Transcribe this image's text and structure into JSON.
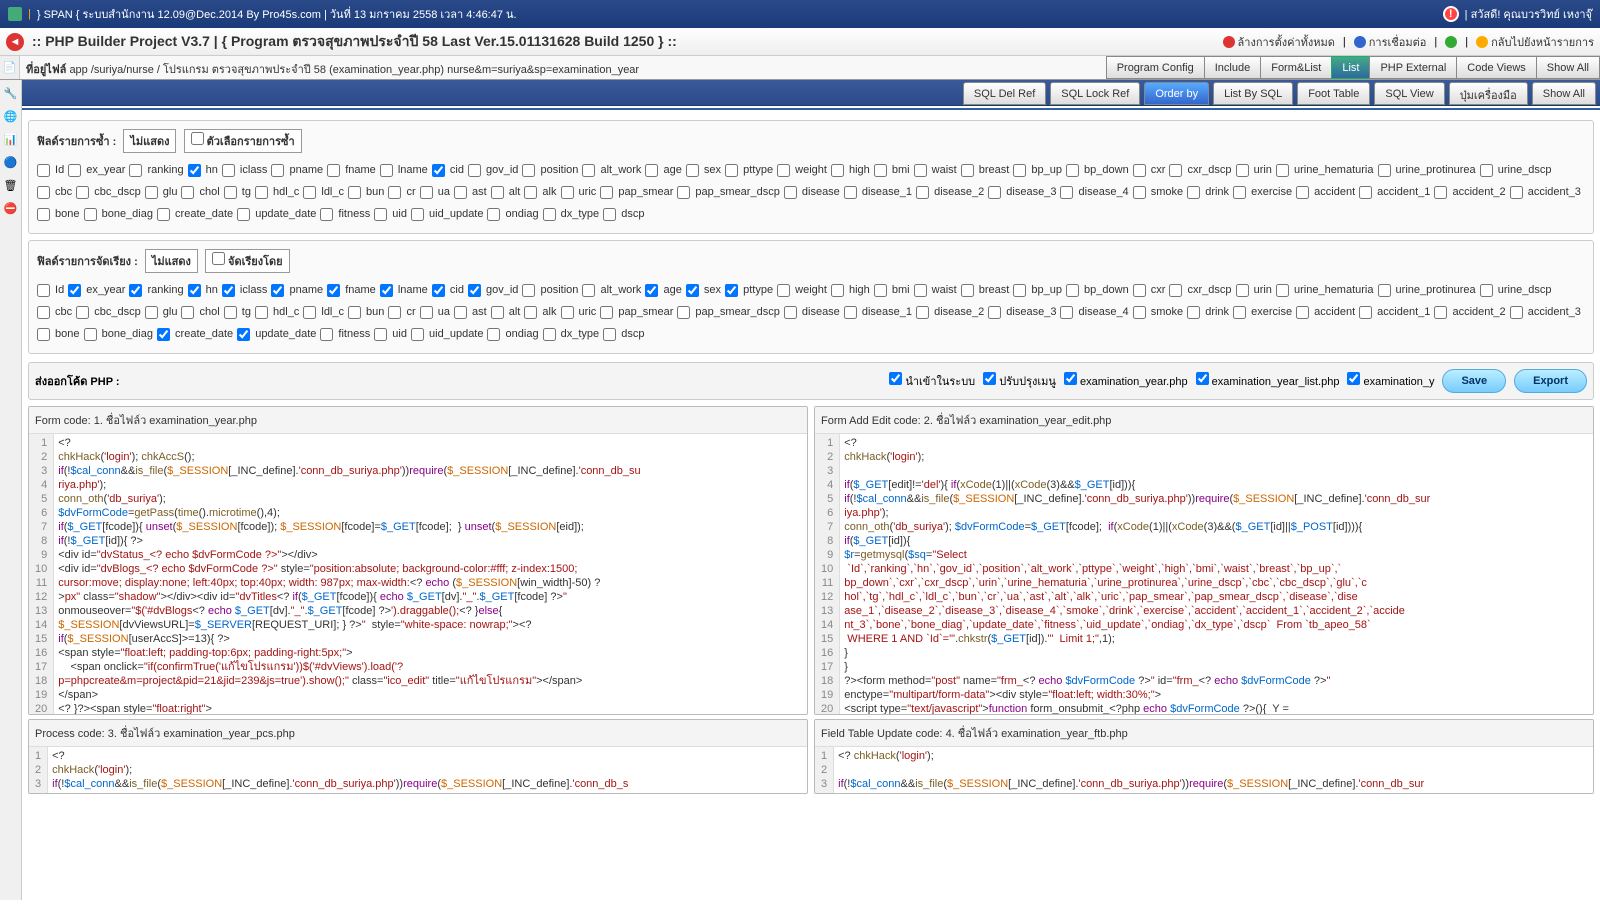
{
  "titlebar": {
    "left": "} SPAN { ระบบสำนักงาน 12.09@Dec.2014 By Pro45s.com | วันที่ 13 มกราคม 2558 เวลา 4:46:47 น.",
    "right": "| สวัสดี! คุณบวรวิทย์ เหงาจุ๊"
  },
  "subheader": {
    "title": ":: PHP Builder Project V3.7 | { Program ตรวจสุขภาพประจำปี 58 Last Ver.15.01131628 Build 1250 } ::",
    "actions": {
      "clear": "ล้างการตั้งค่าทั้งหมด",
      "connect": "การเชื่อมต่อ",
      "back": "กลับไปยังหน้ารายการ"
    }
  },
  "pathbar": {
    "label": "ที่อยู่ไฟล์",
    "path": "app /suriya/nurse / โปรแกรม ตรวจสุขภาพประจำปี 58 (examination_year.php) nurse&m=suriya&sp=examination_year",
    "tabs": [
      "Program Config",
      "Include",
      "Form&List",
      "List",
      "PHP External",
      "Code Views",
      "Show All"
    ],
    "active": 3
  },
  "toolbar2": {
    "tabs": [
      "SQL Del Ref",
      "SQL Lock Ref",
      "Order by",
      "List By SQL",
      "Foot Table",
      "SQL View",
      "ปุ่มเครื่องมือ",
      "Show All"
    ],
    "active": 2
  },
  "fieldRepeat": {
    "title": "ฟิลด์รายการซ้ำ :",
    "box1": "ไม่แสดง",
    "box2": "ตัวเลือกรายการซ้ำ"
  },
  "fieldSort": {
    "title": "ฟิลด์รายการจัดเรียง :",
    "box1": "ไม่แสดง",
    "box2": "จัดเรียงโดย"
  },
  "fields": [
    "Id",
    "ex_year",
    "ranking",
    "hn",
    "iclass",
    "pname",
    "fname",
    "lname",
    "cid",
    "gov_id",
    "position",
    "alt_work",
    "age",
    "sex",
    "pttype",
    "weight",
    "high",
    "bmi",
    "waist",
    "breast",
    "bp_up",
    "bp_down",
    "cxr",
    "cxr_dscp",
    "urin",
    "urine_hematuria",
    "urine_protinurea",
    "urine_dscp",
    "cbc",
    "cbc_dscp",
    "glu",
    "chol",
    "tg",
    "hdl_c",
    "ldl_c",
    "bun",
    "cr",
    "ua",
    "ast",
    "alt",
    "alk",
    "uric",
    "pap_smear",
    "pap_smear_dscp",
    "disease",
    "disease_1",
    "disease_2",
    "disease_3",
    "disease_4",
    "smoke",
    "drink",
    "exercise",
    "accident",
    "accident_1",
    "accident_2",
    "accident_3",
    "bone",
    "bone_diag",
    "create_date",
    "update_date",
    "fitness",
    "uid",
    "uid_update",
    "ondiag",
    "dx_type",
    "dscp"
  ],
  "checked1": {
    "hn": true,
    "cid": true
  },
  "checked2": {
    "ex_year": true,
    "ranking": true,
    "hn": true,
    "iclass": true,
    "pname": true,
    "fname": true,
    "lname": true,
    "cid": true,
    "gov_id": true,
    "age": true,
    "sex": true,
    "pttype": true,
    "create_date": true,
    "update_date": true
  },
  "phpexport": {
    "title": "ส่งออกโค้ด PHP :",
    "opts": [
      "นำเข้าในระบบ",
      "ปรับปรุงเมนู",
      "examination_year.php",
      "examination_year_list.php",
      "examination_y"
    ],
    "save": "Save",
    "export": "Export"
  },
  "codepanels": {
    "p1": {
      "title": "Form code:",
      "sub": "1. ชื่อไฟล์ว examination_year.php"
    },
    "p2": {
      "title": "Form Add Edit code:",
      "sub": "2. ชื่อไฟล์ว examination_year_edit.php"
    },
    "p3": {
      "title": "Process code:",
      "sub": "3. ชื่อไฟล์ว examination_year_pcs.php"
    },
    "p4": {
      "title": "Field Table Update code:",
      "sub": "4. ชื่อไฟล์ว examination_year_ftb.php"
    }
  }
}
